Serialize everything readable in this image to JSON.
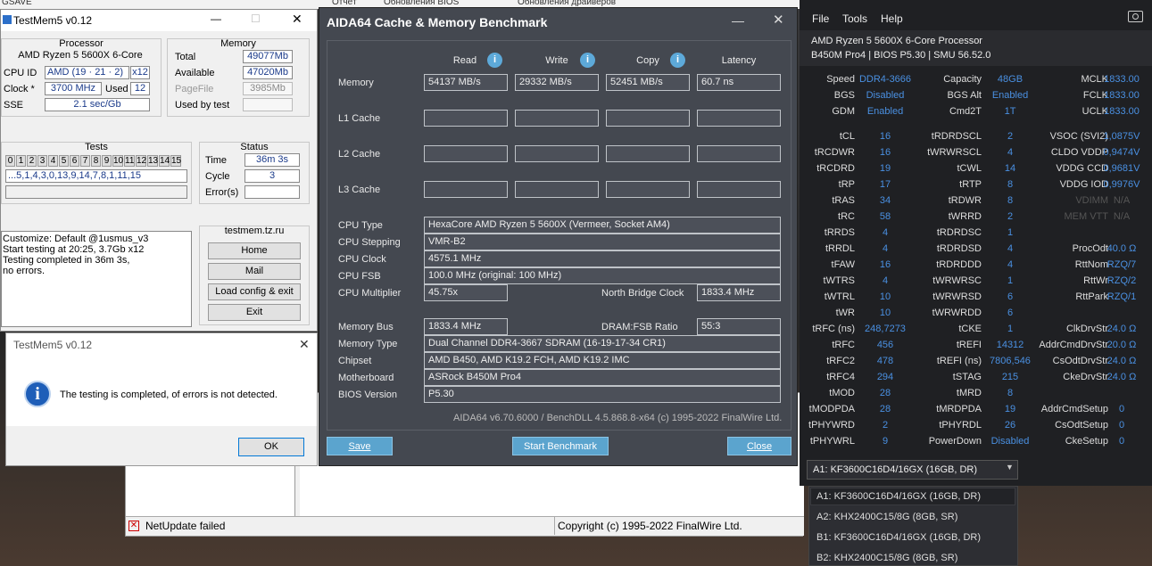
{
  "taskbar": {
    "items": [
      "GSAVE",
      "Отчёт",
      "Обновления BIOS",
      "Обновления драйверов"
    ]
  },
  "backapp": {
    "status_text": "NetUpdate failed",
    "copyright": "Copyright (c) 1995-2022 FinalWire Ltd."
  },
  "testmem": {
    "title": "TestMem5 v0.12",
    "processor": {
      "title": "Processor",
      "name": "AMD Ryzen 5 5600X 6-Core",
      "cpu_id_label": "CPU ID",
      "cpu_id_vendor": "AMD",
      "cpu_id_val": "(19 · 21 · 2)",
      "cpu_id_threads": "x12",
      "clock_label": "Clock *",
      "clock_val": "3700 MHz",
      "used_label": "Used",
      "used_val": "12",
      "sse_label": "SSE",
      "sse_val": "2.1 sec/Gb"
    },
    "memory": {
      "title": "Memory",
      "total_label": "Total",
      "total_val": "49077Mb",
      "avail_label": "Available",
      "avail_val": "47020Mb",
      "pagefile_label": "PageFile",
      "pagefile_val": "3985Mb",
      "usedby_label": "Used by test"
    },
    "tests": {
      "title": "Tests",
      "numbers": [
        "0",
        "1",
        "2",
        "3",
        "4",
        "5",
        "6",
        "7",
        "8",
        "9",
        "10",
        "11",
        "12",
        "13",
        "14",
        "15"
      ],
      "sequence": "...5,1,4,3,0,13,9,14,7,8,1,11,15"
    },
    "status": {
      "title": "Status",
      "time_label": "Time",
      "time_val": "36m 3s",
      "cycle_label": "Cycle",
      "cycle_val": "3",
      "errors_label": "Error(s)"
    },
    "log": [
      "Customize: Default @1usmus_v3",
      "Start testing at 20:25, 3.7Gb x12",
      "Testing completed in 36m 3s,",
      "no errors."
    ],
    "site": {
      "title": "testmem.tz.ru",
      "home": "Home",
      "mail": "Mail",
      "load": "Load config & exit",
      "exit": "Exit"
    }
  },
  "dialog": {
    "title": "TestMem5 v0.12",
    "message": "The testing is completed, of errors is not detected.",
    "ok": "OK"
  },
  "aida": {
    "title": "AIDA64 Cache & Memory Benchmark",
    "headers": {
      "read": "Read",
      "write": "Write",
      "copy": "Copy",
      "latency": "Latency"
    },
    "rows": {
      "memory": "Memory",
      "l1": "L1 Cache",
      "l2": "L2 Cache",
      "l3": "L3 Cache"
    },
    "memory_vals": {
      "read": "54137 MB/s",
      "write": "29332 MB/s",
      "copy": "52451 MB/s",
      "latency": "60.7 ns"
    },
    "info": {
      "cpu_type_label": "CPU Type",
      "cpu_type": "HexaCore AMD Ryzen 5 5600X (Vermeer, Socket AM4)",
      "cpu_stepping_label": "CPU Stepping",
      "cpu_stepping": "VMR-B2",
      "cpu_clock_label": "CPU Clock",
      "cpu_clock": "4575.1 MHz",
      "cpu_fsb_label": "CPU FSB",
      "cpu_fsb": "100.0 MHz (original: 100 MHz)",
      "cpu_mult_label": "CPU Multiplier",
      "cpu_mult": "45.75x",
      "nb_clock_label": "North Bridge Clock",
      "nb_clock": "1833.4 MHz",
      "mem_bus_label": "Memory Bus",
      "mem_bus": "1833.4 MHz",
      "dram_fsb_label": "DRAM:FSB Ratio",
      "dram_fsb": "55:3",
      "mem_type_label": "Memory Type",
      "mem_type": "Dual Channel DDR4-3667 SDRAM (16-19-17-34 CR1)",
      "chipset_label": "Chipset",
      "chipset": "AMD B450, AMD K19.2 FCH, AMD K19.2 IMC",
      "mobo_label": "Motherboard",
      "mobo": "ASRock B450M Pro4",
      "bios_label": "BIOS Version",
      "bios": "P5.30"
    },
    "footer": "AIDA64 v6.70.6000 / BenchDLL 4.5.868.8-x64 (c) 1995-2022 FinalWire Ltd.",
    "buttons": {
      "save": "Save",
      "start": "Start Benchmark",
      "close": "Close"
    }
  },
  "zen": {
    "menu": [
      "File",
      "Tools",
      "Help"
    ],
    "cpu": "AMD Ryzen 5 5600X 6-Core Processor",
    "board": "B450M Pro4 | BIOS P5.30 | SMU 56.52.0",
    "top": [
      [
        "Speed",
        "DDR4-3666",
        "Capacity",
        "48GB",
        "MCLK",
        "1833.00"
      ],
      [
        "BGS",
        "Disabled",
        "BGS Alt",
        "Enabled",
        "FCLK",
        "1833.00"
      ],
      [
        "GDM",
        "Enabled",
        "Cmd2T",
        "1T",
        "UCLK",
        "1833.00"
      ]
    ],
    "timings": [
      [
        "tCL",
        "16",
        "tRDRDSCL",
        "2",
        "VSOC (SVI2)",
        "1,0875V"
      ],
      [
        "tRCDWR",
        "16",
        "tWRWRSCL",
        "4",
        "CLDO VDDP",
        "0,9474V"
      ],
      [
        "tRCDRD",
        "19",
        "tCWL",
        "14",
        "VDDG CCD",
        "0,9681V"
      ],
      [
        "tRP",
        "17",
        "tRTP",
        "8",
        "VDDG IOD",
        "0,9976V"
      ],
      [
        "tRAS",
        "34",
        "tRDWR",
        "8",
        "VDIMM",
        "N/A"
      ],
      [
        "tRC",
        "58",
        "tWRRD",
        "2",
        "MEM VTT",
        "N/A"
      ],
      [
        "tRRDS",
        "4",
        "tRDRDSC",
        "1",
        "",
        ""
      ],
      [
        "tRRDL",
        "4",
        "tRDRDSD",
        "4",
        "ProcOdt",
        "40.0 Ω"
      ],
      [
        "tFAW",
        "16",
        "tRDRDDD",
        "4",
        "RttNom",
        "RZQ/7"
      ],
      [
        "tWTRS",
        "4",
        "tWRWRSC",
        "1",
        "RttWr",
        "RZQ/2"
      ],
      [
        "tWTRL",
        "10",
        "tWRWRSD",
        "6",
        "RttPark",
        "RZQ/1"
      ],
      [
        "tWR",
        "10",
        "tWRWRDD",
        "6",
        "",
        ""
      ],
      [
        "tRFC (ns)",
        "248,7273",
        "tCKE",
        "1",
        "ClkDrvStr",
        "24.0 Ω"
      ],
      [
        "tRFC",
        "456",
        "tREFI",
        "14312",
        "AddrCmdDrvStr",
        "20.0 Ω"
      ],
      [
        "tRFC2",
        "478",
        "tREFI (ns)",
        "7806,546",
        "CsOdtDrvStr",
        "24.0 Ω"
      ],
      [
        "tRFC4",
        "294",
        "tSTAG",
        "215",
        "CkeDrvStr",
        "24.0 Ω"
      ],
      [
        "tMOD",
        "28",
        "tMRD",
        "8",
        "",
        ""
      ],
      [
        "tMODPDA",
        "28",
        "tMRDPDA",
        "19",
        "AddrCmdSetup",
        "0"
      ],
      [
        "tPHYWRD",
        "2",
        "tPHYRDL",
        "26",
        "CsOdtSetup",
        "0"
      ],
      [
        "tPHYWRL",
        "9",
        "PowerDown",
        "Disabled",
        "CkeSetup",
        "0"
      ]
    ],
    "selected": "A1: KF3600C16D4/16GX (16GB, DR)",
    "options": [
      "A1: KF3600C16D4/16GX (16GB, DR)",
      "A2: KHX2400C15/8G (8GB, SR)",
      "B1: KF3600C16D4/16GX (16GB, DR)",
      "B2: KHX2400C15/8G (8GB, SR)"
    ]
  }
}
